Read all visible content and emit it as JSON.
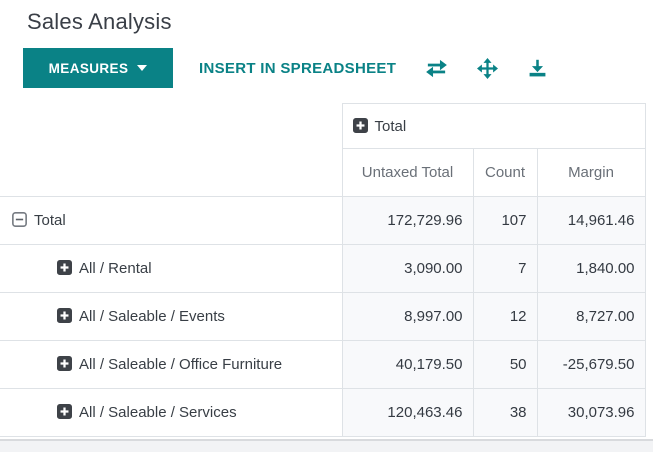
{
  "page": {
    "title": "Sales Analysis"
  },
  "toolbar": {
    "measures_label": "MEASURES",
    "insert_label": "INSERT IN SPREADSHEET",
    "icons": {
      "measures_caret": "caret-down",
      "flip_axis": "exchange-arrows",
      "expand_all": "move-arrows",
      "download": "download"
    }
  },
  "pivot": {
    "col_group_label": "Total",
    "col_group_icon": "plus-square",
    "measure_headers": [
      "Untaxed Total",
      "Count",
      "Margin"
    ],
    "rows": [
      {
        "label": "Total",
        "icon": "minus-square",
        "indent": 0,
        "untaxed_total": "172,729.96",
        "count": "107",
        "margin": "14,961.46"
      },
      {
        "label": "All / Rental",
        "icon": "plus-square",
        "indent": 1,
        "untaxed_total": "3,090.00",
        "count": "7",
        "margin": "1,840.00"
      },
      {
        "label": "All / Saleable / Events",
        "icon": "plus-square",
        "indent": 1,
        "untaxed_total": "8,997.00",
        "count": "12",
        "margin": "8,727.00"
      },
      {
        "label": "All / Saleable / Office Furniture",
        "icon": "plus-square",
        "indent": 1,
        "untaxed_total": "40,179.50",
        "count": "50",
        "margin": "-25,679.50"
      },
      {
        "label": "All / Saleable / Services",
        "icon": "plus-square",
        "indent": 1,
        "untaxed_total": "120,463.46",
        "count": "38",
        "margin": "30,073.96"
      }
    ]
  },
  "colors": {
    "accent": "#0a8286",
    "body_text": "#383e45",
    "muted_text": "#6a7078",
    "cell_background": "#f8f9fb",
    "border": "#dee2e6",
    "row_icon_dark": "#3e4248",
    "bottom_strip": "#f2f3f5"
  }
}
